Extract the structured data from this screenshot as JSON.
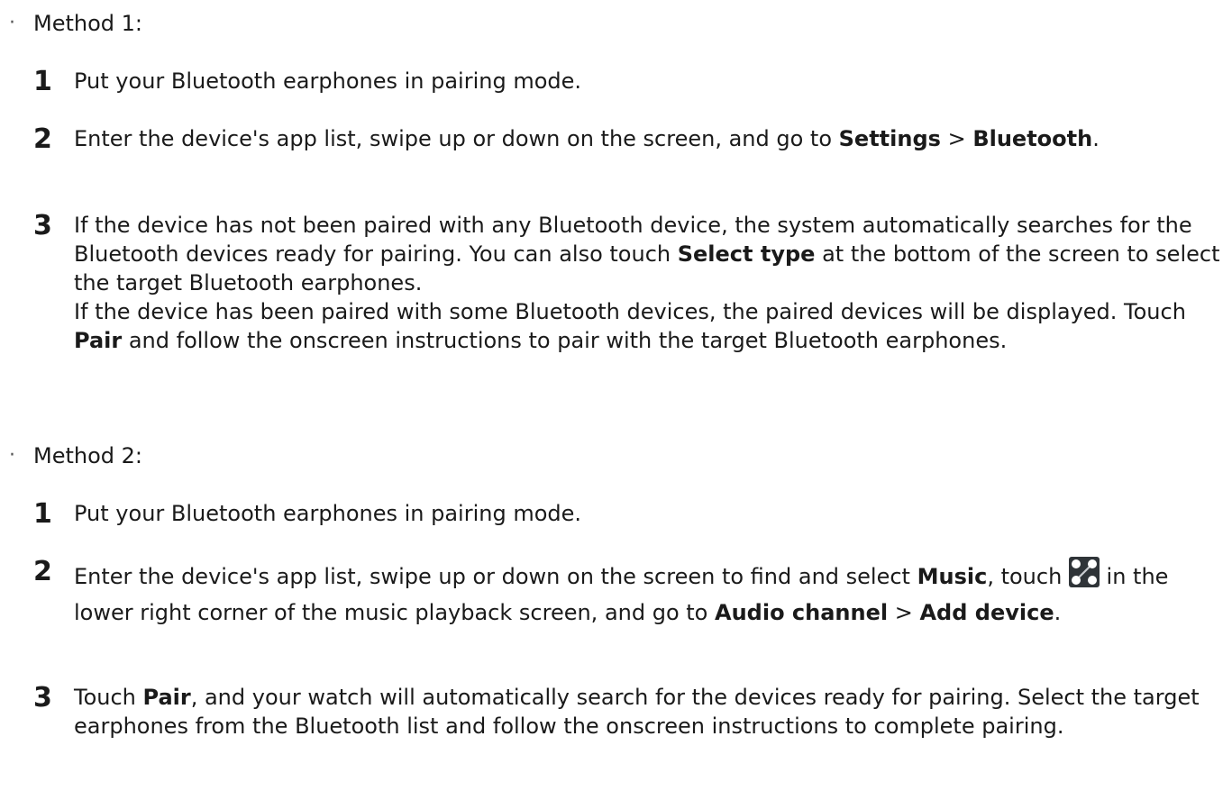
{
  "methods": [
    {
      "bullet": "·",
      "label": "Method 1:",
      "steps": [
        {
          "num": "1",
          "segments": [
            {
              "t": "Put your Bluetooth earphones in pairing mode."
            }
          ]
        },
        {
          "num": "2",
          "segments": [
            {
              "t": "Enter the device's app list, swipe up or down on the screen, and go to "
            },
            {
              "b": "Settings"
            },
            {
              "t": " > "
            },
            {
              "b": "Bluetooth"
            },
            {
              "t": "."
            }
          ]
        },
        {
          "num": "3",
          "segments": [
            {
              "t": "If the device has not been paired with any Bluetooth device, the system automatically searches for the Bluetooth devices ready for pairing. You can also touch "
            },
            {
              "b": "Select type"
            },
            {
              "t": " at the bottom of the screen to select the target Bluetooth earphones."
            }
          ],
          "extra": [
            {
              "t": "If the device has been paired with some Bluetooth devices, the paired devices will be displayed. Touch "
            },
            {
              "b": "Pair"
            },
            {
              "t": " and follow the onscreen instructions to pair with the target Bluetooth earphones."
            }
          ]
        }
      ]
    },
    {
      "bullet": "·",
      "label": "Method 2:",
      "steps": [
        {
          "num": "1",
          "segments": [
            {
              "t": "Put your Bluetooth earphones in pairing mode."
            }
          ]
        },
        {
          "num": "2",
          "segments": [
            {
              "t": "Enter the device's app list, swipe up or down on the screen to find and select "
            },
            {
              "b": "Music"
            },
            {
              "t": ", touch "
            },
            {
              "icon": "audio-channel-icon"
            },
            {
              "t": " in the lower right corner of the music playback screen, and go to "
            },
            {
              "b": "Audio channel"
            },
            {
              "t": " > "
            },
            {
              "b": "Add device"
            },
            {
              "t": "."
            }
          ]
        },
        {
          "num": "3",
          "segments": [
            {
              "t": "Touch "
            },
            {
              "b": "Pair"
            },
            {
              "t": ", and your watch will automatically search for the devices ready for pairing. Select the target earphones from the Bluetooth list and follow the onscreen instructions to complete pairing."
            }
          ]
        }
      ]
    }
  ]
}
